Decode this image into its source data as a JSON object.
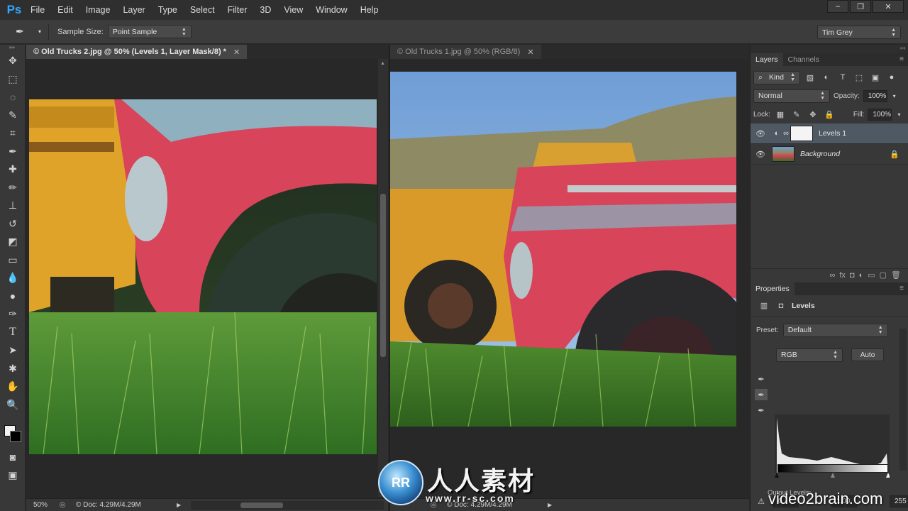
{
  "app": {
    "logo": "Ps",
    "menu": [
      "File",
      "Edit",
      "Image",
      "Layer",
      "Type",
      "Select",
      "Filter",
      "3D",
      "View",
      "Window",
      "Help"
    ],
    "window_controls": [
      "–",
      "❐",
      "✕"
    ]
  },
  "options": {
    "sample_size_label": "Sample Size:",
    "sample_size_value": "Point Sample",
    "workspace": "Tim Grey"
  },
  "tools": [
    "move-tool",
    "marquee-tool",
    "lasso-tool",
    "quick-selection-tool",
    "crop-tool",
    "eyedropper-tool",
    "healing-brush-tool",
    "brush-tool",
    "clone-stamp-tool",
    "history-brush-tool",
    "eraser-tool",
    "gradient-tool",
    "blur-tool",
    "dodge-tool",
    "pen-tool",
    "type-tool",
    "path-selection-tool",
    "shape-tool",
    "hand-tool",
    "zoom-tool"
  ],
  "documents": {
    "left": {
      "title": "© Old Trucks 2.jpg @ 50% (Levels 1, Layer Mask/8) *",
      "zoom": "50%",
      "doc_size": "© Doc: 4.29M/4.29M"
    },
    "right": {
      "title": "© Old Trucks 1.jpg @ 50% (RGB/8)",
      "doc_size": "© Doc: 4.29M/4.29M"
    }
  },
  "layers_panel": {
    "tabs": [
      "Layers",
      "Channels"
    ],
    "filter_kind": "Kind",
    "blend_mode": "Normal",
    "opacity_label": "Opacity:",
    "opacity_value": "100%",
    "lock_label": "Lock:",
    "fill_label": "Fill:",
    "fill_value": "100%",
    "layers": [
      {
        "name": "Levels 1",
        "selected": true
      },
      {
        "name": "Background",
        "selected": false,
        "locked": true
      }
    ]
  },
  "properties_panel": {
    "title": "Properties",
    "adjustment": "Levels",
    "preset_label": "Preset:",
    "preset_value": "Default",
    "channel": "RGB",
    "auto_label": "Auto",
    "input_black": "0",
    "input_gamma": "1.00",
    "input_white": "255",
    "output_label": "Output Levels:"
  },
  "watermarks": {
    "logo_text": "RR",
    "cn_text": "人人素材",
    "site_url": "www.rr-sc.com",
    "video_site": "video2brain.com"
  },
  "colors": {
    "accent": "#31a8ff",
    "selected_layer": "#4f5963",
    "panel_bg": "#383838"
  }
}
